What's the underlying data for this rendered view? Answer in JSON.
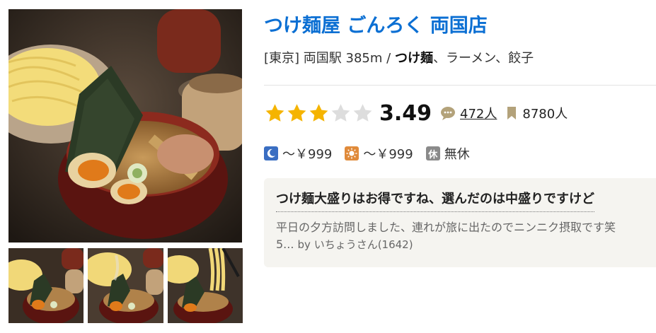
{
  "restaurant": {
    "name": "つけ麺屋 ごんろく 両国店",
    "area": "[東京]",
    "station": "両国駅 385m",
    "separator": "/",
    "genre_main": "つけ麺",
    "genre_rest": "、ラーメン、餃子"
  },
  "rating": {
    "stars_filled": 3,
    "stars_total": 5,
    "score": "3.49",
    "reviews": "472人",
    "bookmarks": "8780人"
  },
  "budget": {
    "dinner": "～￥999",
    "lunch": "～￥999",
    "holiday_icon": "休",
    "holiday": "無休"
  },
  "review": {
    "title": "つけ麺大盛りはお得ですね、選んだのは中盛りですけど",
    "body_line1": "平日の夕方訪問しました、連れが旅に出たのでニンニク摂取です笑",
    "body_line2": "5...",
    "author": "by いちょうさん(1642)"
  },
  "colors": {
    "title": "#0b6fd3",
    "star_filled": "#f5b400",
    "star_empty": "#dddddd",
    "card_bg": "#f5f4f0"
  },
  "icons": [
    "moon-icon",
    "sun-icon",
    "comment-icon",
    "bookmark-icon",
    "star-icon"
  ]
}
